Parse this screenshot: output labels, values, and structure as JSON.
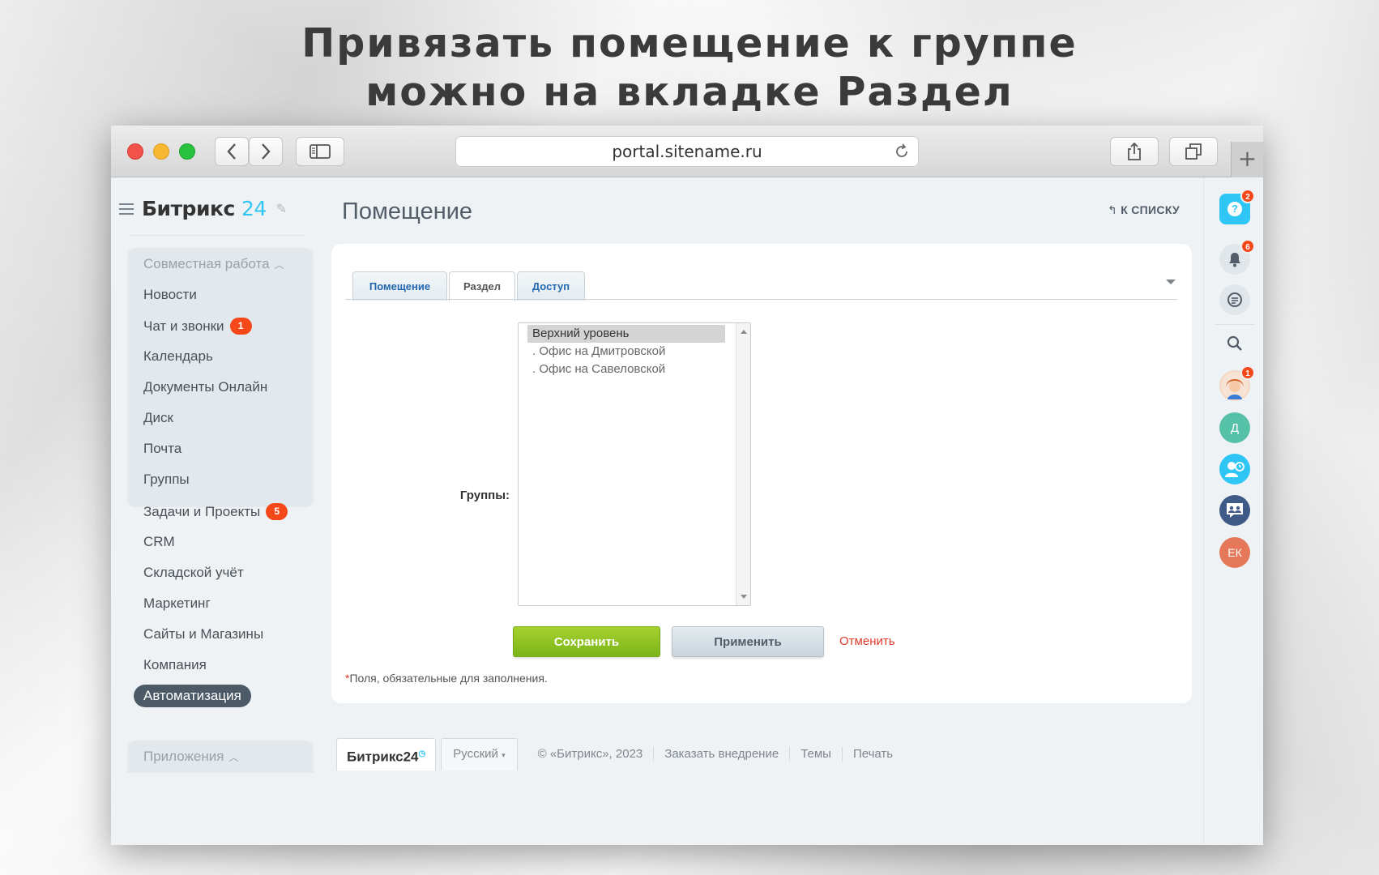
{
  "headline": {
    "line1": "Привязать  помещение к группе",
    "line2": "можно на вкладке Раздел"
  },
  "browser": {
    "url": "portal.sitename.ru"
  },
  "sidebar": {
    "logo_main": "Битрикс",
    "logo_num": "24",
    "group_header": "Совместная работа",
    "items": [
      {
        "label": "Новости"
      },
      {
        "label": "Чат и звонки",
        "badge": "1"
      },
      {
        "label": "Календарь"
      },
      {
        "label": "Документы Онлайн"
      },
      {
        "label": "Диск"
      },
      {
        "label": "Почта"
      },
      {
        "label": "Группы"
      },
      {
        "label": "Задачи и Проекты",
        "badge": "5"
      },
      {
        "label": "CRM"
      },
      {
        "label": "Складской учёт"
      },
      {
        "label": "Маркетинг"
      },
      {
        "label": "Сайты и Магазины"
      },
      {
        "label": "Компания"
      },
      {
        "label": "Автоматизация",
        "active": true
      }
    ],
    "apps_header": "Приложения"
  },
  "main": {
    "title": "Помещение",
    "back_link": "К СПИСКУ",
    "tabs": [
      {
        "label": "Помещение"
      },
      {
        "label": "Раздел",
        "active": true
      },
      {
        "label": "Доступ"
      }
    ],
    "groups_label": "Группы:",
    "groups_options": [
      "Верхний уровень",
      ". Офис на Дмитровской",
      ". Офис на Савеловской"
    ],
    "groups_selected": "Верхний уровень",
    "save_label": "Сохранить",
    "apply_label": "Применить",
    "cancel_label": "Отменить",
    "required_star": "*",
    "required_note": "Поля, обязательные для заполнения."
  },
  "footer": {
    "logo_text": "Битрикс",
    "logo_num": "24",
    "language": "Русский",
    "copyright": "© «Битрикс», 2023",
    "order_link": "Заказать внедрение",
    "themes_link": "Темы",
    "print_link": "Печать"
  },
  "rail": {
    "help_badge": "2",
    "notifications_badge": "6",
    "avatar_badge": "1",
    "user_d_initial": "Д",
    "user_ek_initials": "ЕК"
  },
  "colors": {
    "accent": "#2fc6f6",
    "badge": "#f54819",
    "save_green": "#7cb518",
    "cancel_red": "#e03a2b"
  }
}
